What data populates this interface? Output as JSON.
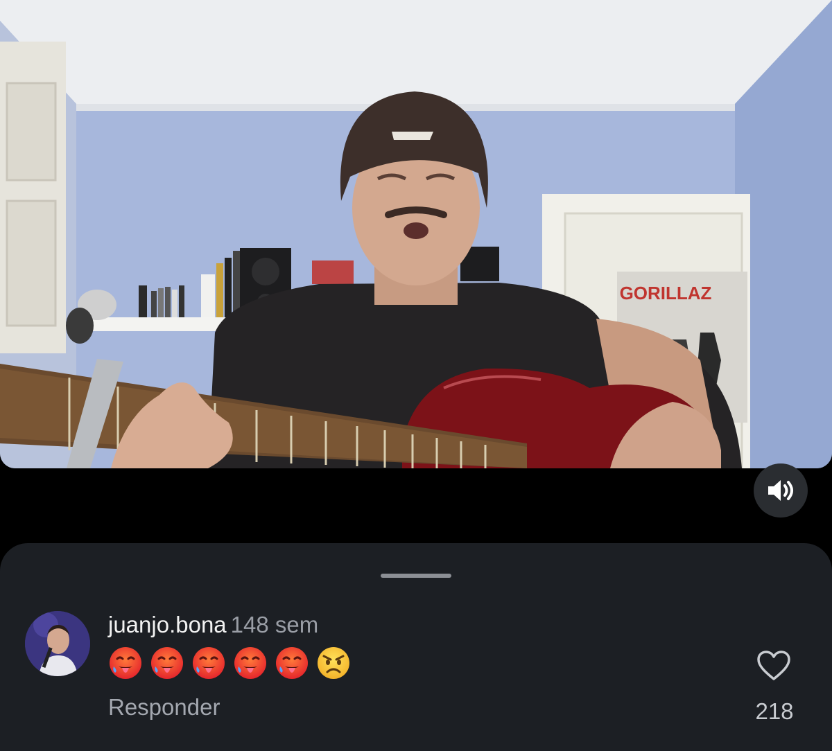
{
  "video": {
    "description_icon": "video-frame",
    "sound_icon": "speaker-sound-on-icon"
  },
  "comment": {
    "username": "juanjo.bona",
    "time": "148 sem",
    "emojis": [
      "hot-face",
      "hot-face",
      "hot-face",
      "hot-face",
      "hot-face",
      "angry-face"
    ],
    "reply_label": "Responder",
    "like_count": "218"
  },
  "colors": {
    "sheet_bg": "#1c1f24",
    "sound_button_bg": "#2a2d31",
    "muted_text": "#9a9ea6"
  }
}
